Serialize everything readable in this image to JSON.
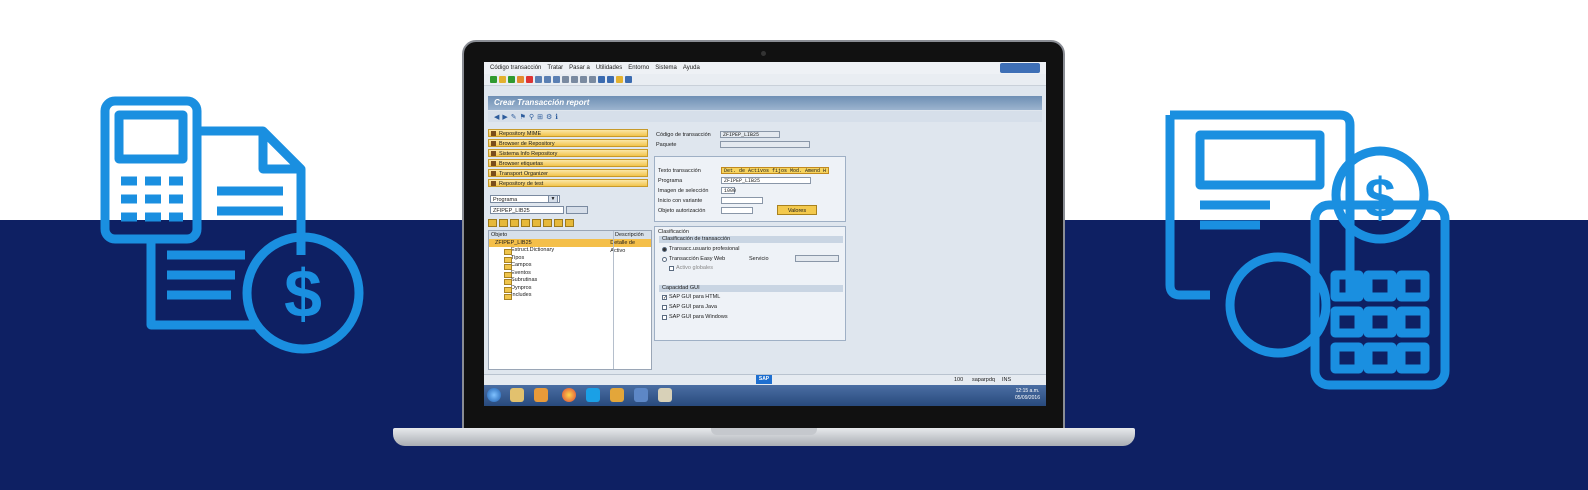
{
  "menu": [
    "Código transacción",
    "Tratar",
    "Pasar a",
    "Utilidades",
    "Entorno",
    "Sistema",
    "Ayuda"
  ],
  "title": "Crear Transacción report",
  "left_buttons": [
    "Repository MIME",
    "Browser de Repository",
    "Sistema Info Repository",
    "Browser etiquetas",
    "Transport Organizer",
    "Repository de test"
  ],
  "object_type": "Programa",
  "object_name": "ZFIPEP_LIB25",
  "tree": {
    "col_object": "Objeto",
    "col_desc": "Descripción",
    "root": "ZFIPEP_LIB25",
    "root_desc": "Detalle de Activo",
    "nodes": [
      "Estruct.Dictionary",
      "Tipos",
      "Campos",
      "Eventos",
      "Subrutinas",
      "Dynpros",
      "Includes"
    ]
  },
  "form": {
    "tcode_label": "Código de transacción",
    "tcode_value": "ZFIPEP_LIB25",
    "package_label": "Paquete",
    "text_label": "Texto transacción",
    "text_value": "Det. de Activos fijos Mod. Amend H",
    "program_label": "Programa",
    "program_value": "ZFIPEP_LIB25",
    "screen_label": "Imagen de selección",
    "screen_value": "1000",
    "variant_label": "Inicio con variante",
    "auth_label": "Objeto autorización",
    "values_button": "Valores",
    "classification_header": "Clasificación",
    "tclass_header": "Clasificación de transacción",
    "opt_professional": "Transacc.usuario profesional",
    "opt_easyweb": "Transacción Easy Web",
    "service_label": "Servicio",
    "global_label": "Activo globales",
    "gui_header": "Capacidad GUI",
    "gui_html": "SAP GUI para HTML",
    "gui_java": "SAP GUI para Java",
    "gui_windows": "SAP GUI para Windows"
  },
  "status": {
    "client": "100",
    "user": "saparpdq",
    "mode": "INS"
  },
  "clock": {
    "time": "12:15 a.m.",
    "date": "05/09/2016"
  },
  "sap_logo": "SAP",
  "colors": {
    "brand_blue": "#1a8fe0",
    "navy": "#0e2063"
  }
}
